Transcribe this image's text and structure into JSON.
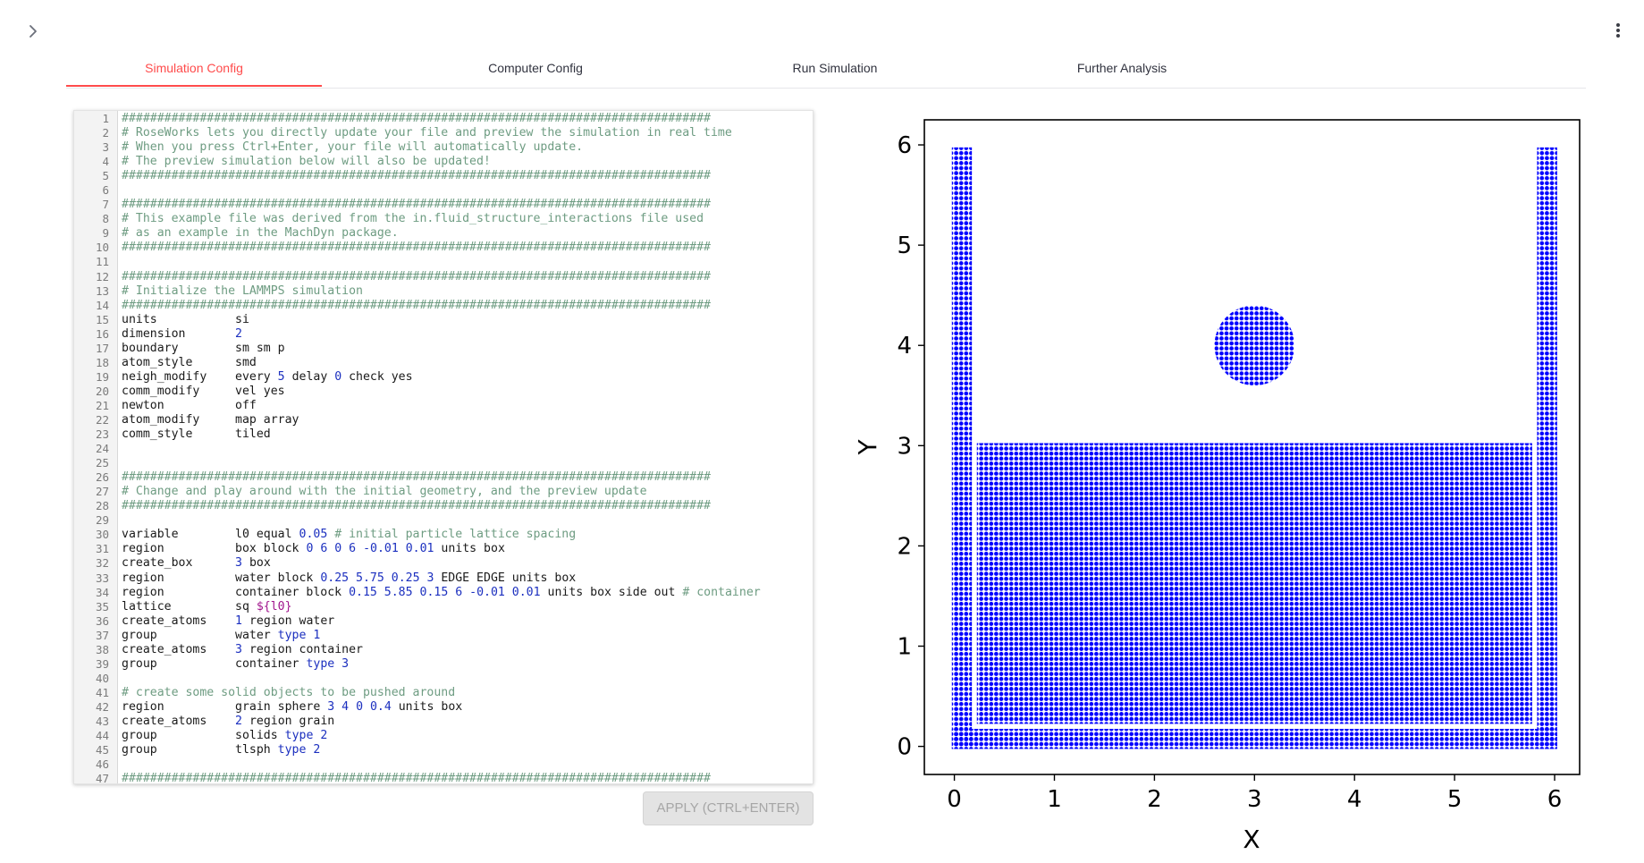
{
  "tabs": [
    {
      "label": "Simulation Config",
      "active": true
    },
    {
      "label": "Computer Config",
      "active": false
    },
    {
      "label": "Run Simulation",
      "active": false
    },
    {
      "label": "Further Analysis",
      "active": false
    }
  ],
  "editor": {
    "lines": [
      "###################################################################################",
      "# RoseWorks lets you directly update your file and preview the simulation in real time",
      "# When you press Ctrl+Enter, your file will automatically update.",
      "# The preview simulation below will also be updated!",
      "###################################################################################",
      "",
      "###################################################################################",
      "# This example file was derived from the in.fluid_structure_interactions file used",
      "# as an example in the MachDyn package.",
      "###################################################################################",
      "",
      "###################################################################################",
      "# Initialize the LAMMPS simulation",
      "###################################################################################",
      "units           si",
      "dimension       2",
      "boundary        sm sm p",
      "atom_style      smd",
      "neigh_modify    every 5 delay 0 check yes",
      "comm_modify     vel yes",
      "newton          off",
      "atom_modify     map array",
      "comm_style      tiled",
      "",
      "",
      "###################################################################################",
      "# Change and play around with the initial geometry, and the preview update",
      "###################################################################################",
      "",
      "variable        l0 equal 0.05 # initial particle lattice spacing",
      "region          box block 0 6 0 6 -0.01 0.01 units box",
      "create_box      3 box",
      "region          water block 0.25 5.75 0.25 3 EDGE EDGE units box",
      "region          container block 0.15 5.85 0.15 6 -0.01 0.01 units box side out # container",
      "lattice         sq ${l0}",
      "create_atoms    1 region water",
      "group           water type 1",
      "create_atoms    3 region container",
      "group           container type 3",
      "",
      "# create some solid objects to be pushed around",
      "region          grain sphere 3 4 0 0.4 units box",
      "create_atoms    2 region grain",
      "group           solids type 2",
      "group           tlsph type 2",
      "",
      "###################################################################################"
    ]
  },
  "apply_button": {
    "label": "APPLY (CTRL+ENTER)",
    "disabled": true
  },
  "chart_data": {
    "type": "scatter",
    "xlabel": "X",
    "ylabel": "Y",
    "xlim": [
      -0.3,
      6.25
    ],
    "ylim": [
      -0.28,
      6.25
    ],
    "xticks": [
      0,
      1,
      2,
      3,
      4,
      5,
      6
    ],
    "yticks": [
      0,
      1,
      2,
      3,
      4,
      5,
      6
    ],
    "marker_color": "#0000ff",
    "grid": false,
    "regions": [
      {
        "name": "water",
        "shape": "block",
        "x": [
          0.25,
          5.75
        ],
        "y": [
          0.25,
          3.0
        ]
      },
      {
        "name": "container-left-wall",
        "shape": "block",
        "x": [
          0.0,
          0.15
        ],
        "y": [
          0.0,
          5.95
        ]
      },
      {
        "name": "container-right-wall",
        "shape": "block",
        "x": [
          5.85,
          6.0
        ],
        "y": [
          0.0,
          5.95
        ]
      },
      {
        "name": "container-floor",
        "shape": "block",
        "x": [
          0.0,
          6.0
        ],
        "y": [
          0.0,
          0.15
        ]
      },
      {
        "name": "grain",
        "shape": "circle",
        "center": [
          3.0,
          4.0
        ],
        "radius": 0.4
      }
    ]
  }
}
